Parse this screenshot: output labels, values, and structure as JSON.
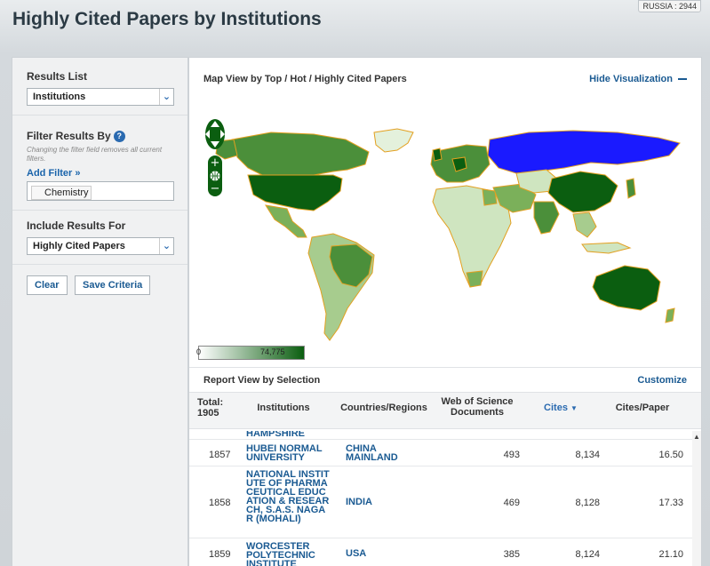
{
  "page": {
    "title": "Highly Cited Papers by Institutions",
    "region_badge": "RUSSIA : 2944"
  },
  "sidebar": {
    "results_list": {
      "label": "Results List",
      "selected": "Institutions"
    },
    "filter": {
      "label": "Filter Results By",
      "hint": "Changing the filter field removes all current filters.",
      "add_filter": "Add Filter »",
      "chip": "Chemistry"
    },
    "include": {
      "label": "Include Results For",
      "selected": "Highly Cited Papers"
    },
    "buttons": {
      "clear": "Clear",
      "save": "Save Criteria"
    }
  },
  "map": {
    "title": "Map View by Top / Hot / Highly Cited Papers",
    "hide_label": "Hide Visualization",
    "legend": {
      "min": "0",
      "max": "74,775"
    },
    "colors": {
      "ocean": "#ffffff",
      "border": "#e3a020",
      "low": "#e4f1dc",
      "mid": "#7bb05a",
      "high": "#0b5e10",
      "highlight": "#1a1aff"
    },
    "icons": {
      "pan": "pan-icon",
      "zoom_in": "zoom-in-icon",
      "world": "globe-icon",
      "zoom_out": "zoom-out-icon"
    }
  },
  "report": {
    "title": "Report View by Selection",
    "customize": "Customize",
    "columns": {
      "total_label": "Total:",
      "total_value": "1905",
      "institutions": "Institutions",
      "countries": "Countries/Regions",
      "documents": "Web of Science Documents",
      "cites": "Cites",
      "cites_per_paper": "Cites/Paper"
    },
    "partial_row": "HAMPSHIRE",
    "rows": [
      {
        "rank": "1857",
        "institution": "HUBEI NORMAL UNIVERSITY",
        "country": "CHINA MAINLAND",
        "documents": "493",
        "cites": "8,134",
        "cpp": "16.50"
      },
      {
        "rank": "1858",
        "institution": "NATIONAL INSTITUTE OF PHARMACEUTICAL EDUCATION & RESEARCH, S.A.S. NAGAR (MOHALI)",
        "country": "INDIA",
        "documents": "469",
        "cites": "8,128",
        "cpp": "17.33"
      },
      {
        "rank": "1859",
        "institution": "WORCESTER POLYTECHNIC INSTITUTE",
        "country": "USA",
        "documents": "385",
        "cites": "8,124",
        "cpp": "21.10"
      }
    ]
  }
}
